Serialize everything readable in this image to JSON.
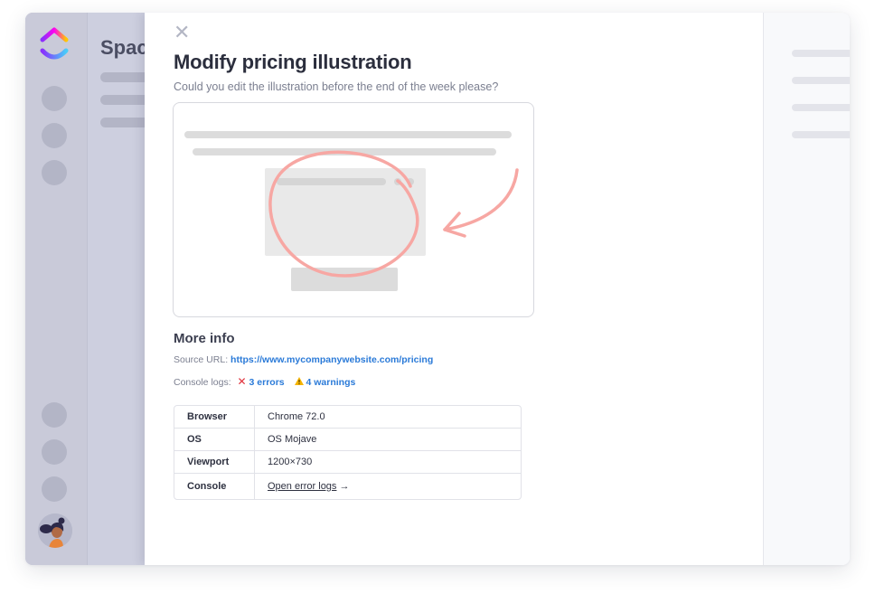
{
  "space": {
    "title": "Space"
  },
  "modal": {
    "close_glyph": "✕",
    "title": "Modify pricing illustration",
    "subtitle": "Could you edit the illustration before the end of the week please?",
    "more_info_heading": "More info",
    "source_url_label": "Source URL:",
    "source_url": "https://www.mycompanywebsite.com/pricing",
    "console_logs_label": "Console logs:",
    "errors_glyph": "✕",
    "errors_text": "3 errors",
    "warnings_glyph": "⚠",
    "warnings_text": "4 warnings",
    "details": [
      {
        "key": "Browser",
        "value": "Chrome 72.0"
      },
      {
        "key": "OS",
        "value": "OS Mojave"
      },
      {
        "key": "Viewport",
        "value": "1200×730"
      },
      {
        "key": "Console",
        "value": "Open error logs",
        "arrow": "→"
      }
    ]
  },
  "colors": {
    "link": "#2a7ad8",
    "error": "#e0303a",
    "warning": "#f5b400",
    "annotation": "#f7a7a3"
  },
  "icons": [
    "logo-icon",
    "close-icon",
    "error-x-icon",
    "warning-icon",
    "arrow-right-icon",
    "avatar"
  ]
}
